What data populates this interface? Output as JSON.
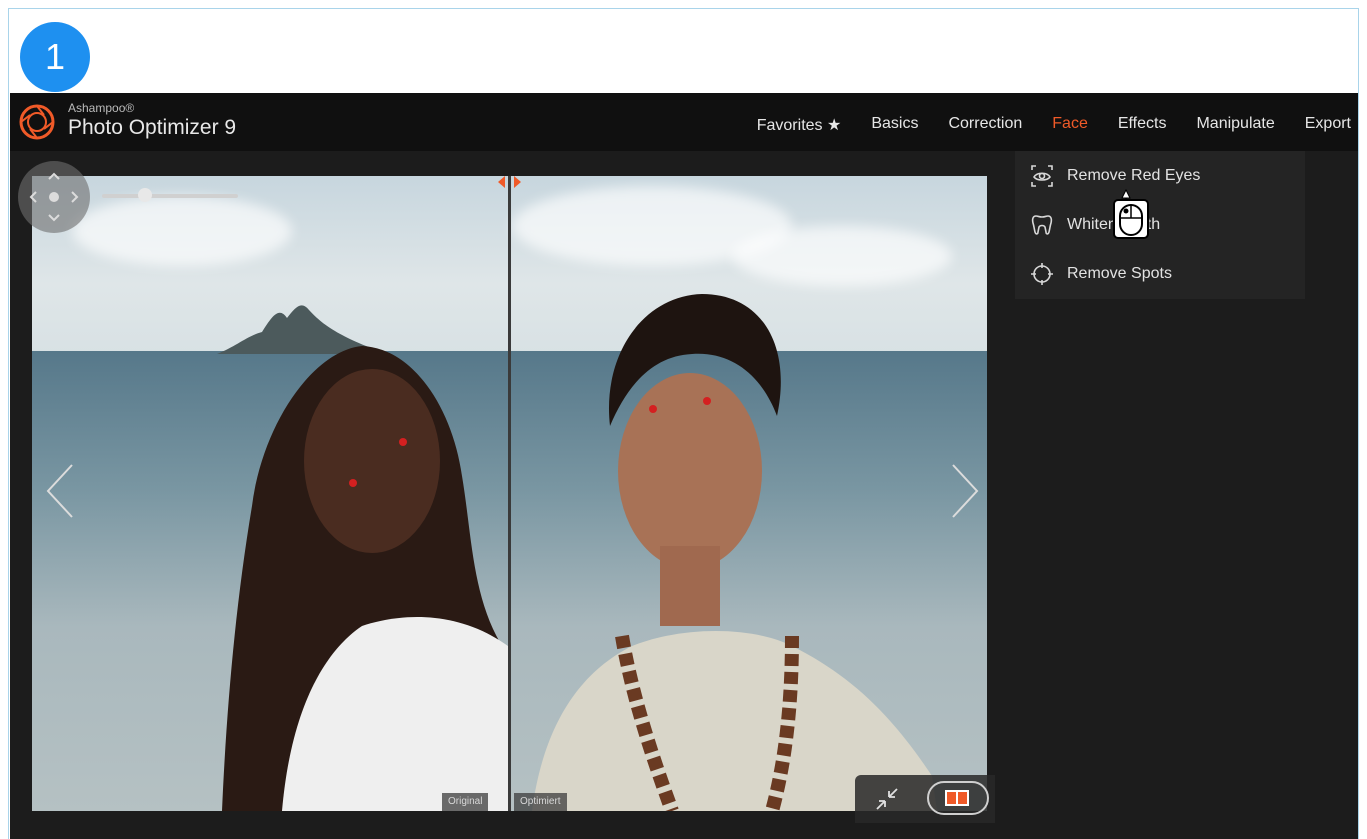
{
  "step": {
    "number": "1"
  },
  "app": {
    "brand_small": "Ashampoo®",
    "brand_name": "Photo Optimizer 9",
    "accent_color": "#f05a28"
  },
  "menu": [
    {
      "label": "Favorites ★",
      "active": false
    },
    {
      "label": "Basics",
      "active": false
    },
    {
      "label": "Correction",
      "active": false
    },
    {
      "label": "Face",
      "active": true
    },
    {
      "label": "Effects",
      "active": false
    },
    {
      "label": "Manipulate",
      "active": false
    },
    {
      "label": "Export",
      "active": false
    }
  ],
  "face_menu": [
    {
      "label": "Remove Red Eyes",
      "icon": "red-eye-icon"
    },
    {
      "label": "Whiten Teeth",
      "icon": "tooth-icon"
    },
    {
      "label": "Remove Spots",
      "icon": "crosshair-icon"
    }
  ],
  "photo": {
    "label_original": "Original",
    "label_optimized": "Optimiert"
  }
}
